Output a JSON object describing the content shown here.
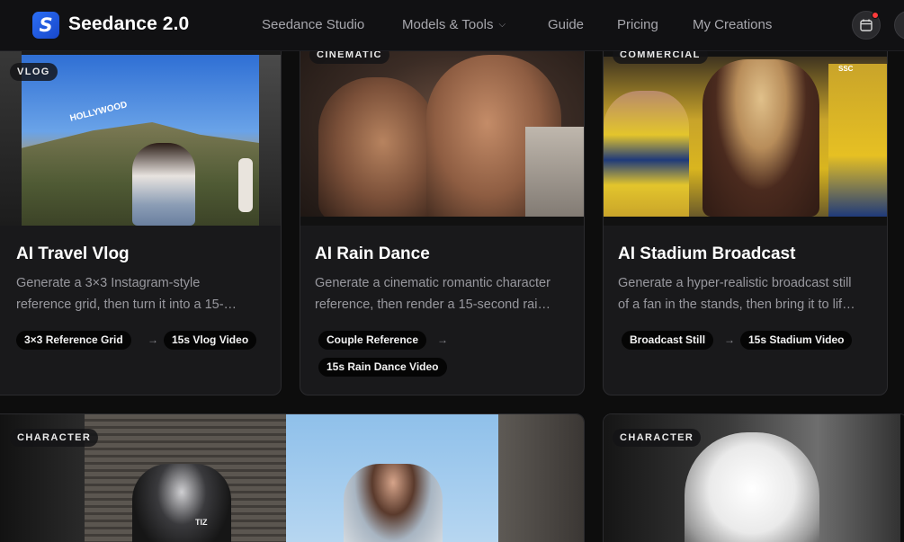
{
  "app": {
    "name": "Seedance 2.0",
    "logo_letter": "S",
    "brand_color": "#2b6ef5"
  },
  "nav": {
    "items": [
      {
        "label": "Seedance Studio"
      },
      {
        "label": "Models & Tools",
        "has_dropdown": true
      },
      {
        "label": "Guide"
      },
      {
        "label": "Pricing"
      },
      {
        "label": "My Creations"
      }
    ]
  },
  "header_icons": {
    "calendar": "calendar-icon",
    "notification_dot_color": "#ff3b3b"
  },
  "cards": [
    {
      "tag": "VLOG",
      "title": "AI Travel Vlog",
      "desc_line1": "Generate a 3×3 Instagram-style",
      "desc_line2": "reference grid, then turn it into a 15-…",
      "chip1": "3×3 Reference Grid",
      "chip2": "15s Vlog Video"
    },
    {
      "tag": "CINEMATIC",
      "title": "AI Rain Dance",
      "desc_line1": "Generate a cinematic romantic character",
      "desc_line2": "reference, then render a 15-second rai…",
      "chip1": "Couple Reference",
      "chip2": "15s Rain Dance Video"
    },
    {
      "tag": "COMMERCIAL",
      "title": "AI Stadium Broadcast",
      "desc_line1": "Generate a hyper-realistic broadcast still",
      "desc_line2": "of a fan in the stands, then bring it to lif…",
      "chip1": "Broadcast Still",
      "chip2": "15s Stadium Video"
    },
    {
      "tag": "CHARACTER"
    },
    {
      "tag": "CHARACTER"
    }
  ],
  "image_text": {
    "hollywood_sign": "HOLLYWOOD",
    "broadcast_logo": "SSC",
    "shirt_text": "TIZ"
  }
}
